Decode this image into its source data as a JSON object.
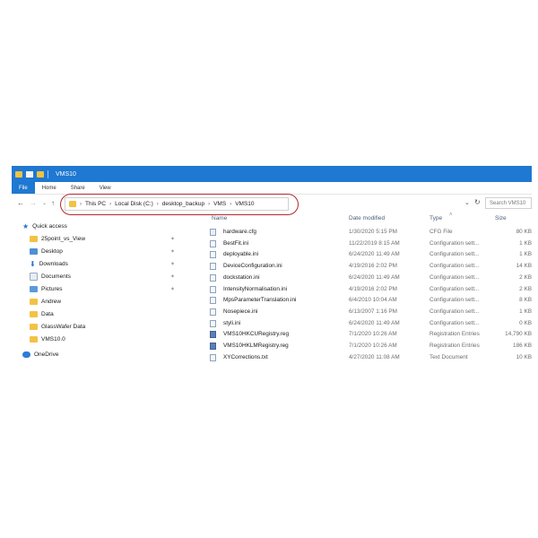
{
  "window": {
    "title": "VMS10",
    "ribbon_tabs": [
      "File",
      "Home",
      "Share",
      "View"
    ]
  },
  "address": {
    "crumbs": [
      "This PC",
      "Local Disk (C:)",
      "desktop_backup",
      "VMS",
      "VMS10"
    ],
    "search_placeholder": "Search VMS10",
    "highlight_color": "#b5282d"
  },
  "nav": {
    "items": [
      {
        "label": "Quick access",
        "icon": "star-icon",
        "pinned": false
      },
      {
        "label": "25point_vs_View",
        "icon": "folder-icon",
        "pinned": true
      },
      {
        "label": "Desktop",
        "icon": "desktop-icon",
        "pinned": true
      },
      {
        "label": "Downloads",
        "icon": "download-icon",
        "pinned": true
      },
      {
        "label": "Documents",
        "icon": "documents-icon",
        "pinned": true
      },
      {
        "label": "Pictures",
        "icon": "pictures-icon",
        "pinned": true
      },
      {
        "label": "Andrew",
        "icon": "folder-icon",
        "pinned": false
      },
      {
        "label": "Data",
        "icon": "folder-icon",
        "pinned": false
      },
      {
        "label": "GlassWafer Data",
        "icon": "folder-icon",
        "pinned": false
      },
      {
        "label": "VMS10.0",
        "icon": "folder-icon",
        "pinned": false
      },
      {
        "label": "OneDrive",
        "icon": "onedrive-icon",
        "pinned": false
      }
    ]
  },
  "columns": {
    "name": "Name",
    "date": "Date modified",
    "type": "Type",
    "size": "Size"
  },
  "files": [
    {
      "name": "hardware.cfg",
      "date": "1/30/2020 5:15 PM",
      "type": "CFG File",
      "size": "80 KB",
      "icon": "cfg"
    },
    {
      "name": "BestFit.ini",
      "date": "11/22/2019 8:15 AM",
      "type": "Configuration sett...",
      "size": "1 KB",
      "icon": "ini"
    },
    {
      "name": "deployable.ini",
      "date": "6/24/2020 11:49 AM",
      "type": "Configuration sett...",
      "size": "1 KB",
      "icon": "ini"
    },
    {
      "name": "DeviceConfiguration.ini",
      "date": "4/19/2016 2:02 PM",
      "type": "Configuration sett...",
      "size": "14 KB",
      "icon": "ini"
    },
    {
      "name": "dockstation.ini",
      "date": "6/24/2020 11:49 AM",
      "type": "Configuration sett...",
      "size": "2 KB",
      "icon": "ini"
    },
    {
      "name": "IntensityNormalisation.ini",
      "date": "4/19/2016 2:02 PM",
      "type": "Configuration sett...",
      "size": "2 KB",
      "icon": "ini"
    },
    {
      "name": "MpsParameterTranslation.ini",
      "date": "6/4/2010 10:04 AM",
      "type": "Configuration sett...",
      "size": "8 KB",
      "icon": "ini"
    },
    {
      "name": "Nosepiece.ini",
      "date": "6/13/2007 1:16 PM",
      "type": "Configuration sett...",
      "size": "1 KB",
      "icon": "ini"
    },
    {
      "name": "styli.ini",
      "date": "6/24/2020 11:49 AM",
      "type": "Configuration sett...",
      "size": "0 KB",
      "icon": "ini"
    },
    {
      "name": "VMS10HKCURegistry.reg",
      "date": "7/1/2020 10:26 AM",
      "type": "Registration Entries",
      "size": "14,790 KB",
      "icon": "reg"
    },
    {
      "name": "VMS10HKLMRegistry.reg",
      "date": "7/1/2020 10:26 AM",
      "type": "Registration Entries",
      "size": "186 KB",
      "icon": "reg"
    },
    {
      "name": "XYCorrections.txt",
      "date": "4/27/2020 11:08 AM",
      "type": "Text Document",
      "size": "10 KB",
      "icon": "txt"
    }
  ]
}
